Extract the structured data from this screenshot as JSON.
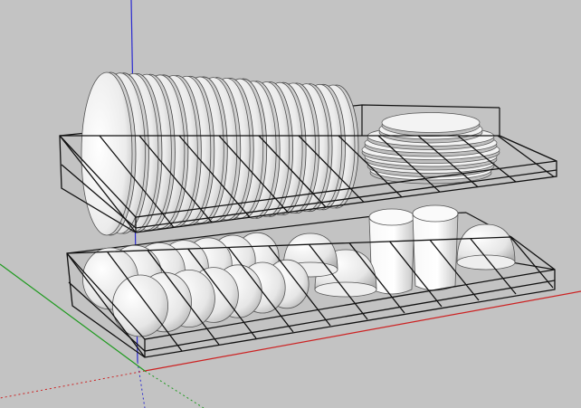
{
  "viewport": {
    "background": "#c3c3c3",
    "axis_colors": {
      "x": "#cc2222",
      "y": "#1f9a1f",
      "z": "#2a2ad0"
    }
  },
  "model": {
    "name": "dish-rack",
    "tiers": 2,
    "upper_tier": {
      "plate_count": 18,
      "saucer_stack_count": 8
    },
    "lower_tier": {
      "bowl_count": 14,
      "tall_cup_count": 2,
      "small_bowl_count": 3
    },
    "colors": {
      "wireframe": "#111111",
      "dish_fill": "#f4f4f4",
      "dish_shade": "#bdbdbd",
      "dish_edge": "#555555"
    }
  }
}
